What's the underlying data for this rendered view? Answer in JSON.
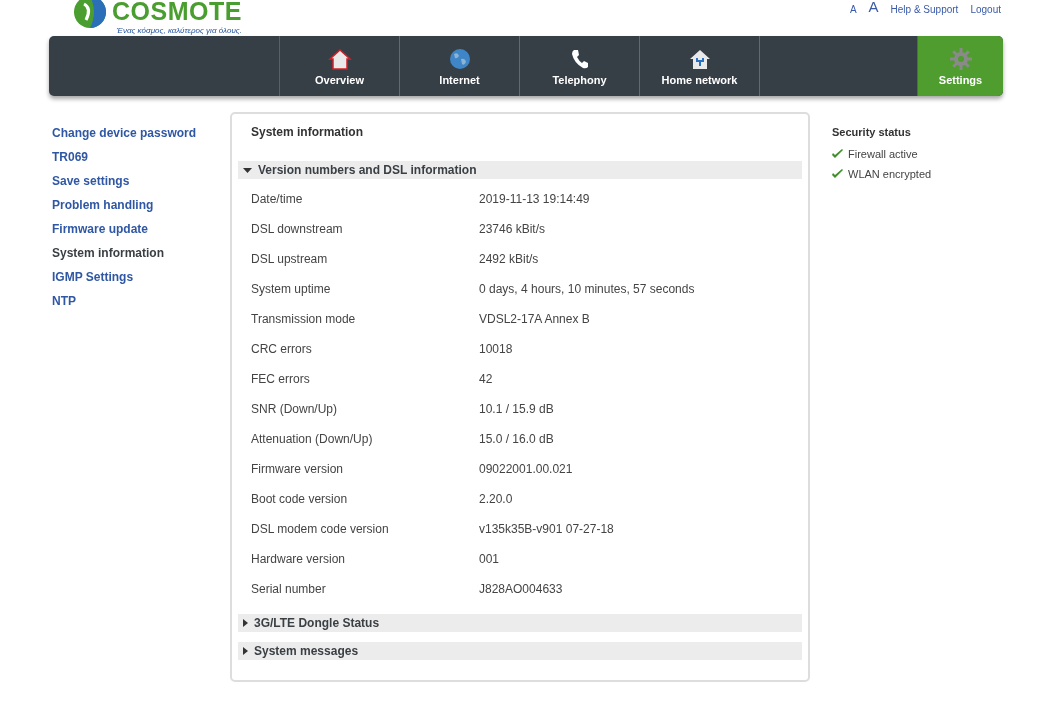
{
  "logo": {
    "name": "COSMOTE",
    "tagline": "Ένας κόσμος, καλύτερος για όλους."
  },
  "top_links": [
    {
      "kind": "font-small",
      "label": "A"
    },
    {
      "kind": "font-large",
      "label": "A"
    },
    {
      "kind": "link",
      "label": "Help & Support"
    },
    {
      "kind": "link",
      "label": "Logout"
    }
  ],
  "nav": [
    {
      "kind": "home",
      "label": "Overview",
      "selected": false
    },
    {
      "kind": "globe",
      "label": "Internet",
      "selected": false
    },
    {
      "kind": "phone",
      "label": "Telephony",
      "selected": false
    },
    {
      "kind": "network",
      "label": "Home network",
      "selected": false
    },
    {
      "kind": "gear",
      "label": "Settings",
      "selected": true
    }
  ],
  "sidebar": [
    {
      "label": "Change device password",
      "selected": false
    },
    {
      "label": "TR069",
      "selected": false
    },
    {
      "label": "Save settings",
      "selected": false
    },
    {
      "label": "Problem handling",
      "selected": false
    },
    {
      "label": "Firmware update",
      "selected": false
    },
    {
      "label": "System information",
      "selected": true
    },
    {
      "label": "IGMP Settings",
      "selected": false
    },
    {
      "label": "NTP",
      "selected": false
    }
  ],
  "panel": {
    "title": "System information",
    "sections": [
      {
        "title": "Version numbers and DSL information",
        "expanded": true,
        "rows": [
          {
            "label": "Date/time",
            "value": "2019-11-13 19:14:49"
          },
          {
            "label": "DSL downstream",
            "value": "23746 kBit/s"
          },
          {
            "label": "DSL upstream",
            "value": "2492 kBit/s"
          },
          {
            "label": "System uptime",
            "value": "0 days, 4 hours, 10 minutes, 57 seconds"
          },
          {
            "label": "Transmission mode",
            "value": "VDSL2-17A Annex B"
          },
          {
            "label": "CRC errors",
            "value": "10018"
          },
          {
            "label": "FEC errors",
            "value": "42"
          },
          {
            "label": "SNR (Down/Up)",
            "value": "10.1 / 15.9 dB"
          },
          {
            "label": "Attenuation (Down/Up)",
            "value": "15.0 / 16.0 dB"
          },
          {
            "label": "Firmware version",
            "value": "09022001.00.021"
          },
          {
            "label": "Boot code version",
            "value": "2.20.0"
          },
          {
            "label": "DSL modem code version",
            "value": "v135k35B-v901 07-27-18"
          },
          {
            "label": "Hardware version",
            "value": "001"
          },
          {
            "label": "Serial number",
            "value": "J828AO004633"
          }
        ]
      },
      {
        "title": "3G/LTE Dongle Status",
        "expanded": false
      },
      {
        "title": "System messages",
        "expanded": false
      }
    ]
  },
  "security": {
    "title": "Security status",
    "items": [
      {
        "label": "Firewall active",
        "ok": true
      },
      {
        "label": "WLAN encrypted",
        "ok": true
      }
    ]
  }
}
